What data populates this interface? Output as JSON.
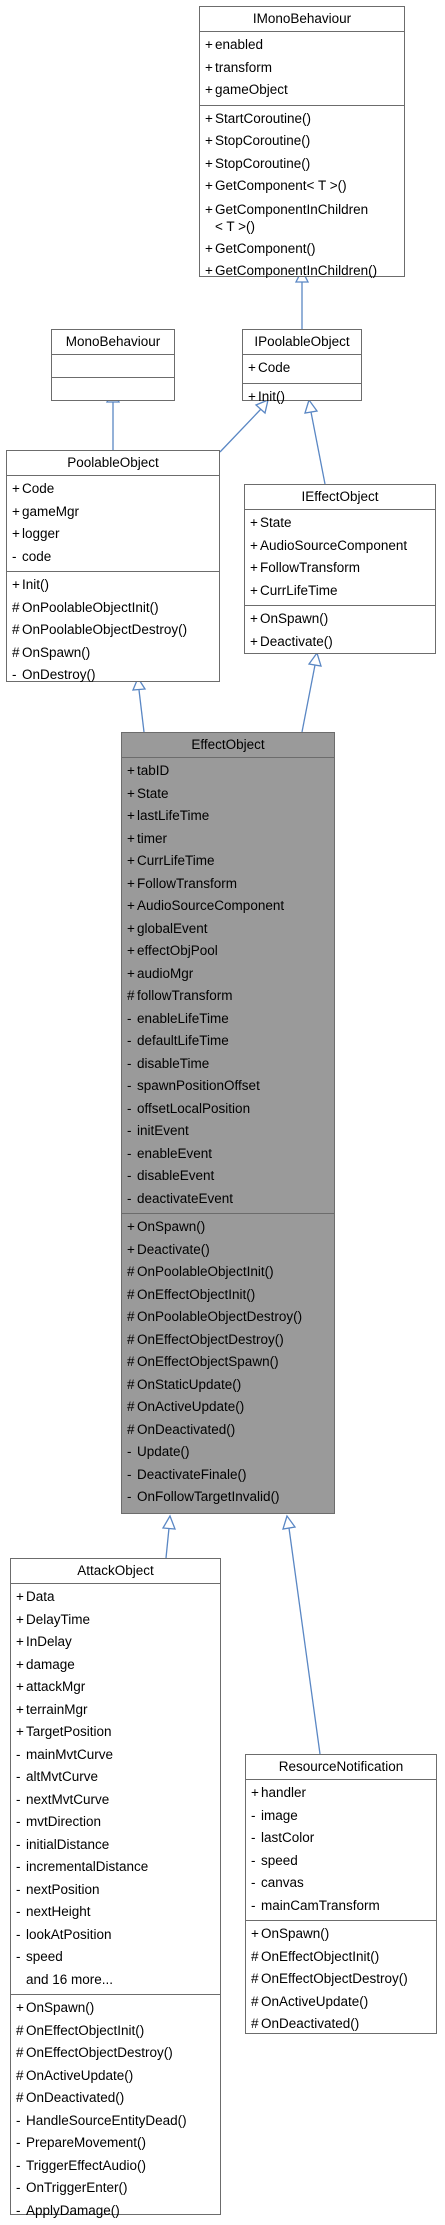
{
  "classes": {
    "imonobehaviour": {
      "title": "IMonoBehaviour",
      "attributes": [
        {
          "vis": "+",
          "text": "enabled"
        },
        {
          "vis": "+",
          "text": "transform"
        },
        {
          "vis": "+",
          "text": "gameObject"
        }
      ],
      "methods": [
        {
          "vis": "+",
          "text": "StartCoroutine()"
        },
        {
          "vis": "+",
          "text": "StopCoroutine()"
        },
        {
          "vis": "+",
          "text": "StopCoroutine()"
        },
        {
          "vis": "+",
          "text": "GetComponent< T >()"
        },
        {
          "vis": "+",
          "text": "GetComponentInChildren\n< T >()"
        },
        {
          "vis": "+",
          "text": "GetComponent()"
        },
        {
          "vis": "+",
          "text": "GetComponentInChildren()"
        }
      ]
    },
    "monobehaviour": {
      "title": "MonoBehaviour",
      "attributes": [],
      "methods": []
    },
    "ipoolableobject": {
      "title": "IPoolableObject",
      "attributes": [
        {
          "vis": "+",
          "text": "Code"
        }
      ],
      "methods": [
        {
          "vis": "+",
          "text": "Init()"
        }
      ]
    },
    "poolableobject": {
      "title": "PoolableObject",
      "attributes": [
        {
          "vis": "+",
          "text": "Code"
        },
        {
          "vis": "+",
          "text": "gameMgr"
        },
        {
          "vis": "+",
          "text": "logger"
        },
        {
          "vis": "-",
          "text": "code"
        }
      ],
      "methods": [
        {
          "vis": "+",
          "text": "Init()"
        },
        {
          "vis": "#",
          "text": "OnPoolableObjectInit()"
        },
        {
          "vis": "#",
          "text": "OnPoolableObjectDestroy()"
        },
        {
          "vis": "#",
          "text": "OnSpawn()"
        },
        {
          "vis": "-",
          "text": "OnDestroy()"
        }
      ]
    },
    "ieffectobject": {
      "title": "IEffectObject",
      "attributes": [
        {
          "vis": "+",
          "text": "State"
        },
        {
          "vis": "+",
          "text": "AudioSourceComponent"
        },
        {
          "vis": "+",
          "text": "FollowTransform"
        },
        {
          "vis": "+",
          "text": "CurrLifeTime"
        }
      ],
      "methods": [
        {
          "vis": "+",
          "text": "OnSpawn()"
        },
        {
          "vis": "+",
          "text": "Deactivate()"
        }
      ]
    },
    "effectobject": {
      "title": "EffectObject",
      "attributes": [
        {
          "vis": "+",
          "text": "tabID"
        },
        {
          "vis": "+",
          "text": "State"
        },
        {
          "vis": "+",
          "text": "lastLifeTime"
        },
        {
          "vis": "+",
          "text": "timer"
        },
        {
          "vis": "+",
          "text": "CurrLifeTime"
        },
        {
          "vis": "+",
          "text": "FollowTransform"
        },
        {
          "vis": "+",
          "text": "AudioSourceComponent"
        },
        {
          "vis": "+",
          "text": "globalEvent"
        },
        {
          "vis": "+",
          "text": "effectObjPool"
        },
        {
          "vis": "+",
          "text": "audioMgr"
        },
        {
          "vis": "#",
          "text": "followTransform"
        },
        {
          "vis": "-",
          "text": "enableLifeTime"
        },
        {
          "vis": "-",
          "text": "defaultLifeTime"
        },
        {
          "vis": "-",
          "text": "disableTime"
        },
        {
          "vis": "-",
          "text": "spawnPositionOffset"
        },
        {
          "vis": "-",
          "text": "offsetLocalPosition"
        },
        {
          "vis": "-",
          "text": "initEvent"
        },
        {
          "vis": "-",
          "text": "enableEvent"
        },
        {
          "vis": "-",
          "text": "disableEvent"
        },
        {
          "vis": "-",
          "text": "deactivateEvent"
        }
      ],
      "methods": [
        {
          "vis": "+",
          "text": "OnSpawn()"
        },
        {
          "vis": "+",
          "text": "Deactivate()"
        },
        {
          "vis": "#",
          "text": "OnPoolableObjectInit()"
        },
        {
          "vis": "#",
          "text": "OnEffectObjectInit()"
        },
        {
          "vis": "#",
          "text": "OnPoolableObjectDestroy()"
        },
        {
          "vis": "#",
          "text": "OnEffectObjectDestroy()"
        },
        {
          "vis": "#",
          "text": "OnEffectObjectSpawn()"
        },
        {
          "vis": "#",
          "text": "OnStaticUpdate()"
        },
        {
          "vis": "#",
          "text": "OnActiveUpdate()"
        },
        {
          "vis": "#",
          "text": "OnDeactivated()"
        },
        {
          "vis": "-",
          "text": "Update()"
        },
        {
          "vis": "-",
          "text": "DeactivateFinale()"
        },
        {
          "vis": "-",
          "text": "OnFollowTargetInvalid()"
        }
      ]
    },
    "attackobject": {
      "title": "AttackObject",
      "attributes": [
        {
          "vis": "+",
          "text": "Data"
        },
        {
          "vis": "+",
          "text": "DelayTime"
        },
        {
          "vis": "+",
          "text": "InDelay"
        },
        {
          "vis": "+",
          "text": "damage"
        },
        {
          "vis": "+",
          "text": "attackMgr"
        },
        {
          "vis": "+",
          "text": "terrainMgr"
        },
        {
          "vis": "+",
          "text": "TargetPosition"
        },
        {
          "vis": "-",
          "text": "mainMvtCurve"
        },
        {
          "vis": "-",
          "text": "altMvtCurve"
        },
        {
          "vis": "-",
          "text": "nextMvtCurve"
        },
        {
          "vis": "-",
          "text": "mvtDirection"
        },
        {
          "vis": "-",
          "text": "initialDistance"
        },
        {
          "vis": "-",
          "text": "incrementalDistance"
        },
        {
          "vis": "-",
          "text": "nextPosition"
        },
        {
          "vis": "-",
          "text": "nextHeight"
        },
        {
          "vis": "-",
          "text": "lookAtPosition"
        },
        {
          "vis": "-",
          "text": "speed"
        },
        {
          "vis": "",
          "text": "and 16 more..."
        }
      ],
      "methods": [
        {
          "vis": "+",
          "text": "OnSpawn()"
        },
        {
          "vis": "#",
          "text": "OnEffectObjectInit()"
        },
        {
          "vis": "#",
          "text": "OnEffectObjectDestroy()"
        },
        {
          "vis": "#",
          "text": "OnActiveUpdate()"
        },
        {
          "vis": "#",
          "text": "OnDeactivated()"
        },
        {
          "vis": "-",
          "text": "HandleSourceEntityDead()"
        },
        {
          "vis": "-",
          "text": "PrepareMovement()"
        },
        {
          "vis": "-",
          "text": "TriggerEffectAudio()"
        },
        {
          "vis": "-",
          "text": "OnTriggerEnter()"
        },
        {
          "vis": "-",
          "text": "ApplyDamage()"
        }
      ]
    },
    "resourcenotification": {
      "title": "ResourceNotification",
      "attributes": [
        {
          "vis": "+",
          "text": "handler"
        },
        {
          "vis": "-",
          "text": "image"
        },
        {
          "vis": "-",
          "text": "lastColor"
        },
        {
          "vis": "-",
          "text": "speed"
        },
        {
          "vis": "-",
          "text": "canvas"
        },
        {
          "vis": "-",
          "text": "mainCamTransform"
        }
      ],
      "methods": [
        {
          "vis": "+",
          "text": "OnSpawn()"
        },
        {
          "vis": "#",
          "text": "OnEffectObjectInit()"
        },
        {
          "vis": "#",
          "text": "OnEffectObjectDestroy()"
        },
        {
          "vis": "#",
          "text": "OnActiveUpdate()"
        },
        {
          "vis": "#",
          "text": "OnDeactivated()"
        }
      ]
    }
  },
  "edge_color": "#5a87c4",
  "highlight_color": "#9a9a9a"
}
